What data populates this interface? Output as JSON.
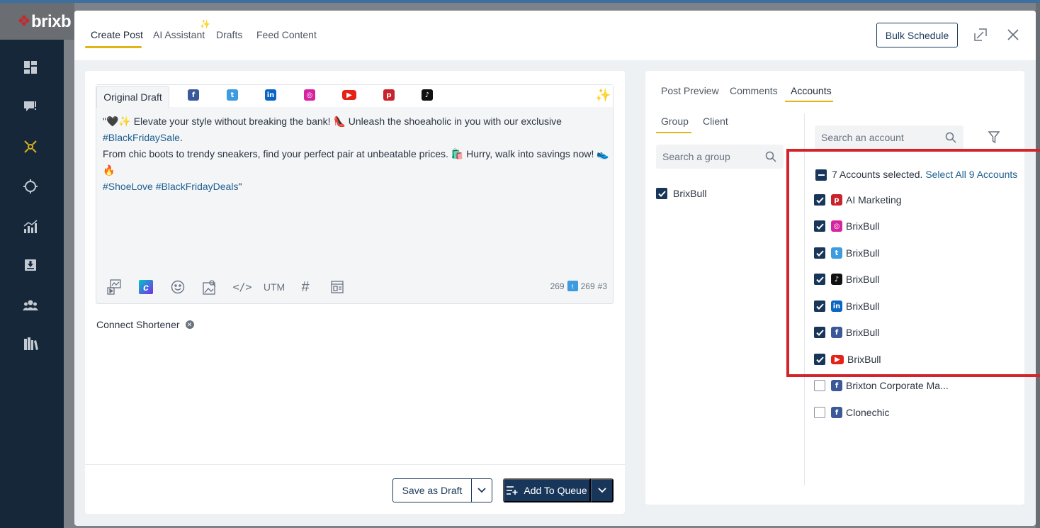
{
  "app": {
    "logo_text": "brixb"
  },
  "modal": {
    "tabs": [
      {
        "label": "Create Post"
      },
      {
        "label": "AI Assistant"
      },
      {
        "label": "Drafts"
      },
      {
        "label": "Feed Content"
      }
    ],
    "bulk_schedule_label": "Bulk Schedule"
  },
  "editor": {
    "draft_tab_label": "Original Draft",
    "network_tabs": [
      "facebook",
      "twitter",
      "linkedin",
      "instagram",
      "youtube",
      "pinterest",
      "tiktok"
    ],
    "text_line1_a": "\"🖤✨ Elevate your style without breaking the bank! 👠 Unleash the shoeaholic in you with our exclusive ",
    "text_line1_tag": "#BlackFridaySale",
    "text_line1_b": ".",
    "text_line2": "From chic boots to trendy sneakers, find your perfect pair at unbeatable prices. 🛍️ Hurry, walk into savings now! 👟🔥",
    "text_line3_tag1": "#ShoeLove",
    "text_line3_tag2": "#BlackFridayDeals",
    "text_line3_end": "\"",
    "toolbar_utm": "UTM",
    "count_main": "269",
    "count_twitter": "269",
    "count_hash": "#3"
  },
  "shortener": {
    "label": "Connect Shortener"
  },
  "footer": {
    "save_draft_label": "Save as Draft",
    "add_queue_label": "Add To Queue"
  },
  "preview": {
    "tabs": [
      {
        "label": "Post Preview"
      },
      {
        "label": "Comments"
      },
      {
        "label": "Accounts"
      }
    ],
    "group_tabs": [
      {
        "label": "Group"
      },
      {
        "label": "Client"
      }
    ],
    "group_search_placeholder": "Search a group",
    "account_search_placeholder": "Search an account",
    "groups": [
      {
        "label": "BrixBull",
        "checked": true
      }
    ],
    "selected_text": "7 Accounts selected.",
    "select_all_text": "Select All 9 Accounts",
    "accounts": [
      {
        "name": "AI Marketing",
        "network": "pinterest",
        "checked": true
      },
      {
        "name": "BrixBull",
        "network": "instagram",
        "checked": true
      },
      {
        "name": "BrixBull",
        "network": "twitter",
        "checked": true
      },
      {
        "name": "BrixBull",
        "network": "tiktok",
        "checked": true
      },
      {
        "name": "BrixBull",
        "network": "linkedin",
        "checked": true
      },
      {
        "name": "BrixBull",
        "network": "facebook",
        "checked": true
      },
      {
        "name": "BrixBull",
        "network": "youtube",
        "checked": true
      },
      {
        "name": "Brixton Corporate Ma...",
        "network": "facebook",
        "checked": false
      },
      {
        "name": "Clonechic",
        "network": "facebook",
        "checked": false
      }
    ]
  },
  "colors": {
    "navy": "#17365a",
    "accent_yellow": "#e0b514",
    "highlight_red": "#d4232b",
    "facebook": "#3b5998",
    "twitter": "#3d9be0",
    "linkedin": "#0a66c2",
    "youtube": "#e62117",
    "pinterest": "#c8232c",
    "tiktok": "#111111",
    "instagram": "#d6249f"
  }
}
